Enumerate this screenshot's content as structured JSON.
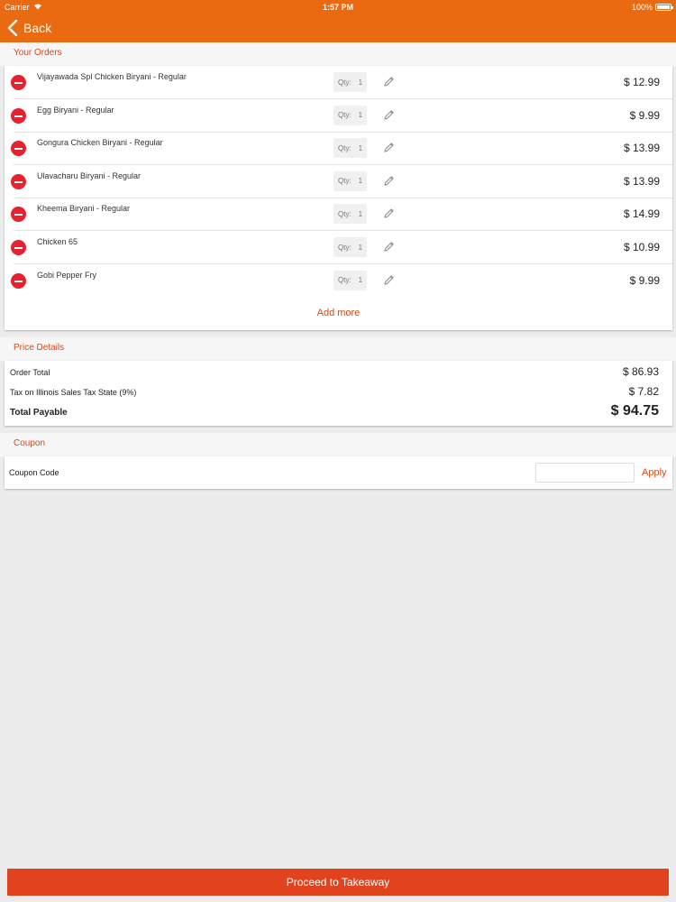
{
  "status_bar": {
    "carrier": "Carrier",
    "time": "1:57 PM",
    "battery": "100%"
  },
  "header": {
    "back_label": "Back"
  },
  "orders": {
    "section_label": "Your Orders",
    "qty_label": "Qty:",
    "items": [
      {
        "name": "Vijayawada Spl Chicken Biryani - Regular",
        "qty": "1",
        "price": "$ 12.99"
      },
      {
        "name": "Egg Biryani - Regular",
        "qty": "1",
        "price": "$ 9.99"
      },
      {
        "name": "Gongura Chicken Biryani - Regular",
        "qty": "1",
        "price": "$ 13.99"
      },
      {
        "name": "Ulavacharu Biryani - Regular",
        "qty": "1",
        "price": "$ 13.99"
      },
      {
        "name": "Kheema Biryani - Regular",
        "qty": "1",
        "price": "$ 14.99"
      },
      {
        "name": "Chicken 65",
        "qty": "1",
        "price": "$ 10.99"
      },
      {
        "name": "Gobi Pepper Fry",
        "qty": "1",
        "price": "$ 9.99"
      }
    ],
    "add_more": "Add more"
  },
  "price_details": {
    "section_label": "Price Details",
    "order_total_label": "Order Total",
    "order_total": "$ 86.93",
    "tax_label": "Tax on  Illinois Sales Tax State (9%)",
    "tax": "$ 7.82",
    "total_label": "Total Payable",
    "total": "$ 94.75"
  },
  "coupon": {
    "section_label": "Coupon",
    "code_label": "Coupon Code",
    "input_value": "",
    "apply_label": "Apply"
  },
  "footer": {
    "proceed_label": "Proceed to Takeaway"
  },
  "colors": {
    "header": "#e96a10",
    "accent": "#d24a1c",
    "remove": "#e8212e",
    "proceed": "#e0431e"
  }
}
